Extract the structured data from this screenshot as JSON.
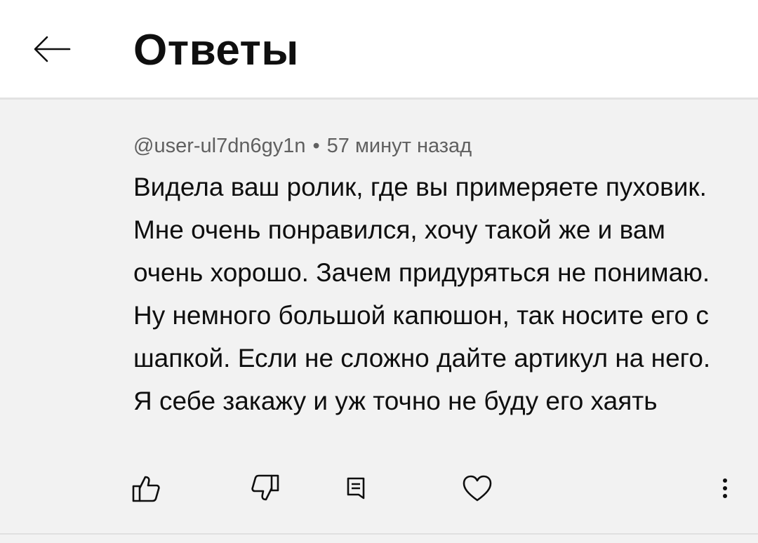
{
  "header": {
    "title": "Ответы",
    "back_icon": "arrow-left-icon"
  },
  "comment": {
    "author": "@user-ul7dn6gy1n",
    "separator": "•",
    "time": "57 минут назад",
    "text": "Видела ваш ролик, где вы примеряете пуховик. Мне очень понравился, хочу такой же и вам очень хорошо. Зачем придуряться не понимаю. Ну немного большой капюшон, так носите его с шапкой. Если не сложно дайте артикул на него. Я себе закажу и уж точно не буду его хаять"
  },
  "actions": {
    "like_icon": "thumbs-up-icon",
    "dislike_icon": "thumbs-down-icon",
    "reply_icon": "reply-comment-icon",
    "heart_icon": "heart-icon",
    "more_icon": "more-vertical-icon"
  },
  "colors": {
    "header_bg": "#ffffff",
    "page_bg": "#f2f2f2",
    "text": "#0f0f0f",
    "meta_text": "#606060"
  }
}
